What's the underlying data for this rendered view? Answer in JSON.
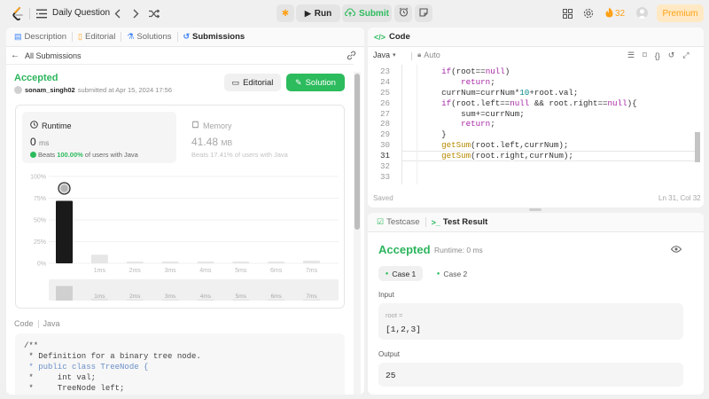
{
  "topbar": {
    "title": "Daily Question",
    "run_label": "Run",
    "submit_label": "Submit",
    "streak_count": "32",
    "premium_label": "Premium"
  },
  "left_tabs": [
    {
      "label": "Description"
    },
    {
      "label": "Editorial"
    },
    {
      "label": "Solutions"
    },
    {
      "label": "Submissions"
    }
  ],
  "submission": {
    "back_label": "All Submissions",
    "status": "Accepted",
    "username": "sonam_singh02",
    "submitted_text": "submitted at Apr 15, 2024 17:56",
    "editorial_btn": "Editorial",
    "solution_btn": "Solution"
  },
  "stats": {
    "runtime_label": "Runtime",
    "runtime_value": "0",
    "runtime_unit": "ms",
    "runtime_beats_prefix": "Beats",
    "runtime_beats_pct": "100.00%",
    "runtime_beats_suffix": "of users with Java",
    "memory_label": "Memory",
    "memory_value": "41.48",
    "memory_unit": "MB",
    "memory_beats_text": "Beats 17.41% of users with Java"
  },
  "chart_data": {
    "type": "bar",
    "y_ticks": [
      "100%",
      "75%",
      "50%",
      "25%",
      "0%"
    ],
    "ylim": [
      0,
      100
    ],
    "x_labels": [
      "1ms",
      "2ms",
      "3ms",
      "4ms",
      "5ms",
      "6ms",
      "7ms"
    ],
    "values": [
      72,
      10,
      2,
      2,
      2,
      2,
      2,
      3
    ],
    "highlight_index": 0,
    "colors": {
      "highlight": "#1a1a1a",
      "other": "#e6e6e6"
    }
  },
  "code_section": {
    "label": "Code",
    "language": "Java",
    "lines": [
      "/**",
      " * Definition for a binary tree node.",
      " * public class TreeNode {",
      " *     int val;",
      " *     TreeNode left;"
    ]
  },
  "editor": {
    "title": "Code",
    "language": "Java",
    "mode": "Auto",
    "line_numbers": [
      "23",
      "24",
      "25",
      "26",
      "27",
      "28",
      "29",
      "30",
      "31",
      "32",
      "33"
    ],
    "saved_label": "Saved",
    "cursor_pos": "Ln 31, Col 32"
  },
  "test": {
    "testcase_tab": "Testcase",
    "result_tab": "Test Result",
    "status": "Accepted",
    "runtime_text": "Runtime: 0 ms",
    "case1": "Case 1",
    "case2": "Case 2",
    "input_label": "Input",
    "var_label": "root =",
    "input_value": "[1,2,3]",
    "output_label": "Output",
    "output_value": "25"
  },
  "colors": {
    "accent_green": "#2cbb5d",
    "accepted_green": "#2db55d",
    "brand_orange": "#ffa116",
    "premium_orange": "#ffa116"
  }
}
